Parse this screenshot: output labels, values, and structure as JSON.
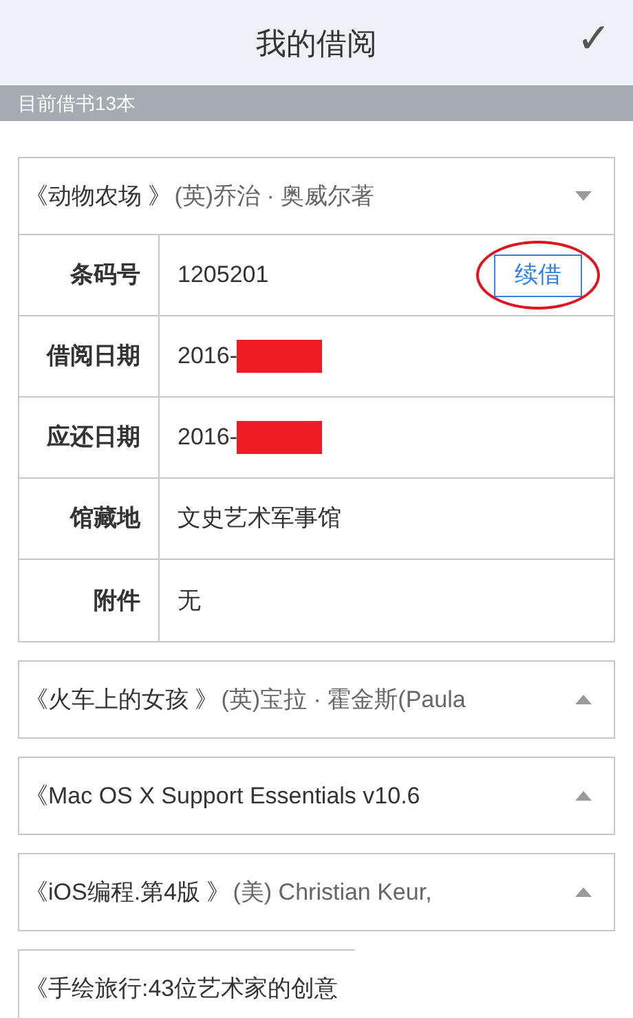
{
  "header": {
    "title": "我的借阅",
    "confirm_icon": "✓"
  },
  "summary": "目前借书13本",
  "loans": [
    {
      "title": "《动物农场 》",
      "author": "(英)乔治 · 奥威尔著",
      "expanded": true,
      "details": [
        {
          "label": "条码号",
          "value": "1205201",
          "action": {
            "label": "续借",
            "highlighted": true
          }
        },
        {
          "label": "借阅日期",
          "value": "2016-",
          "redacted": true
        },
        {
          "label": "应还日期",
          "value": "2016-",
          "redacted": true
        },
        {
          "label": "馆藏地",
          "value": "文史艺术军事馆"
        },
        {
          "label": "附件",
          "value": "无"
        }
      ]
    },
    {
      "title": "《火车上的女孩 》",
      "author": "(英)宝拉 · 霍金斯(Paula",
      "expanded": false
    },
    {
      "title": "《Mac OS X Support Essentials v10.6",
      "expanded": false
    },
    {
      "title": "《iOS编程.第4版 》",
      "author": "(美) Christian Keur,",
      "expanded": false
    },
    {
      "title": "《手绘旅行:43位艺术家的创意",
      "kind": "cut"
    }
  ]
}
